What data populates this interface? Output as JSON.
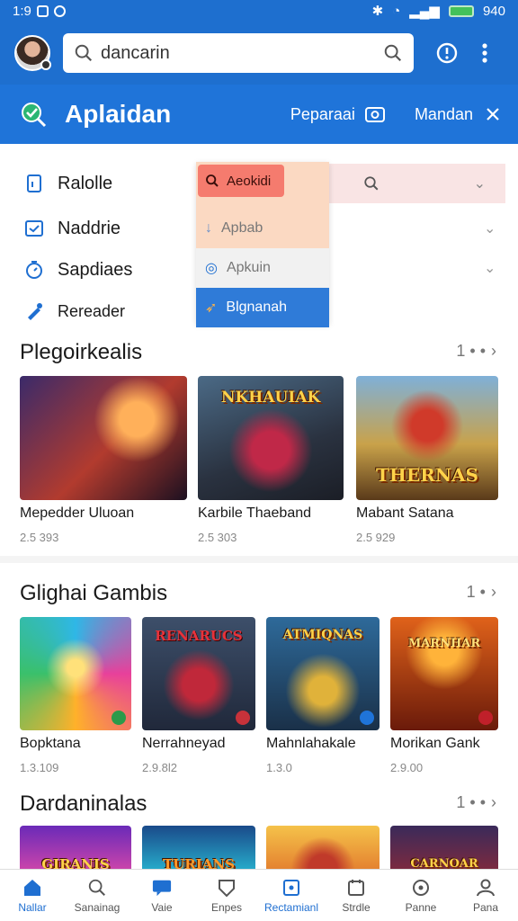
{
  "status_bar": {
    "time": "1:9",
    "battery": "940"
  },
  "search": {
    "value": "dancarin"
  },
  "header": {
    "title": "Aplaidan",
    "action_label": "Peparaai",
    "secondary_label": "Mandan"
  },
  "menu": {
    "items": [
      {
        "label": "Ralolle"
      },
      {
        "label": "Naddrie"
      },
      {
        "label": "Sapdiaes"
      },
      {
        "label": "Rereader"
      }
    ]
  },
  "dropdown": {
    "chip": "Aeokidi",
    "options": [
      {
        "label": "Apbab"
      },
      {
        "label": "Apkuin"
      },
      {
        "label": "Blgnanah"
      }
    ]
  },
  "sections": [
    {
      "title": "Plegoirkealis",
      "more": "1 • •",
      "items": [
        {
          "name": "Mepedder Uluoan",
          "meta": "2.5 393",
          "logo": ""
        },
        {
          "name": "Karbile Thaeband",
          "meta": "2.5 303",
          "logo": "NKHAUIAK"
        },
        {
          "name": "Mabant Satana",
          "meta": "2.5 929",
          "logo": "THERNAS"
        }
      ]
    },
    {
      "title": "Glighai Gambis",
      "more": "1 •",
      "items": [
        {
          "name": "Bopktana",
          "meta": "1.3.109",
          "logo": ""
        },
        {
          "name": "Nerrahneyad",
          "meta": "2.9.8l2",
          "logo": "RENARUCS"
        },
        {
          "name": "Mahnlahakale",
          "meta": "1.3.0",
          "logo": "ATMIQNAS"
        },
        {
          "name": "Morikan Gank",
          "meta": "2.9.00",
          "logo": "MARNHAR"
        }
      ]
    },
    {
      "title": "Dardaninalas",
      "more": "1 • •",
      "items": [
        {
          "logo": "GIRANIS"
        },
        {
          "logo": "TURIANS"
        },
        {
          "logo": ""
        },
        {
          "logo": "CARNOAR"
        }
      ]
    }
  ],
  "bottom_nav": [
    {
      "label": "Nallar"
    },
    {
      "label": "Sanainag"
    },
    {
      "label": "Vaie"
    },
    {
      "label": "Enpes"
    },
    {
      "label": "Rectamianl"
    },
    {
      "label": "Strdle"
    },
    {
      "label": "Panne"
    },
    {
      "label": "Pana"
    }
  ],
  "colors": {
    "primary": "#1e6fcf",
    "titlebar": "#1f74d9",
    "active": "#1f6fd1"
  }
}
